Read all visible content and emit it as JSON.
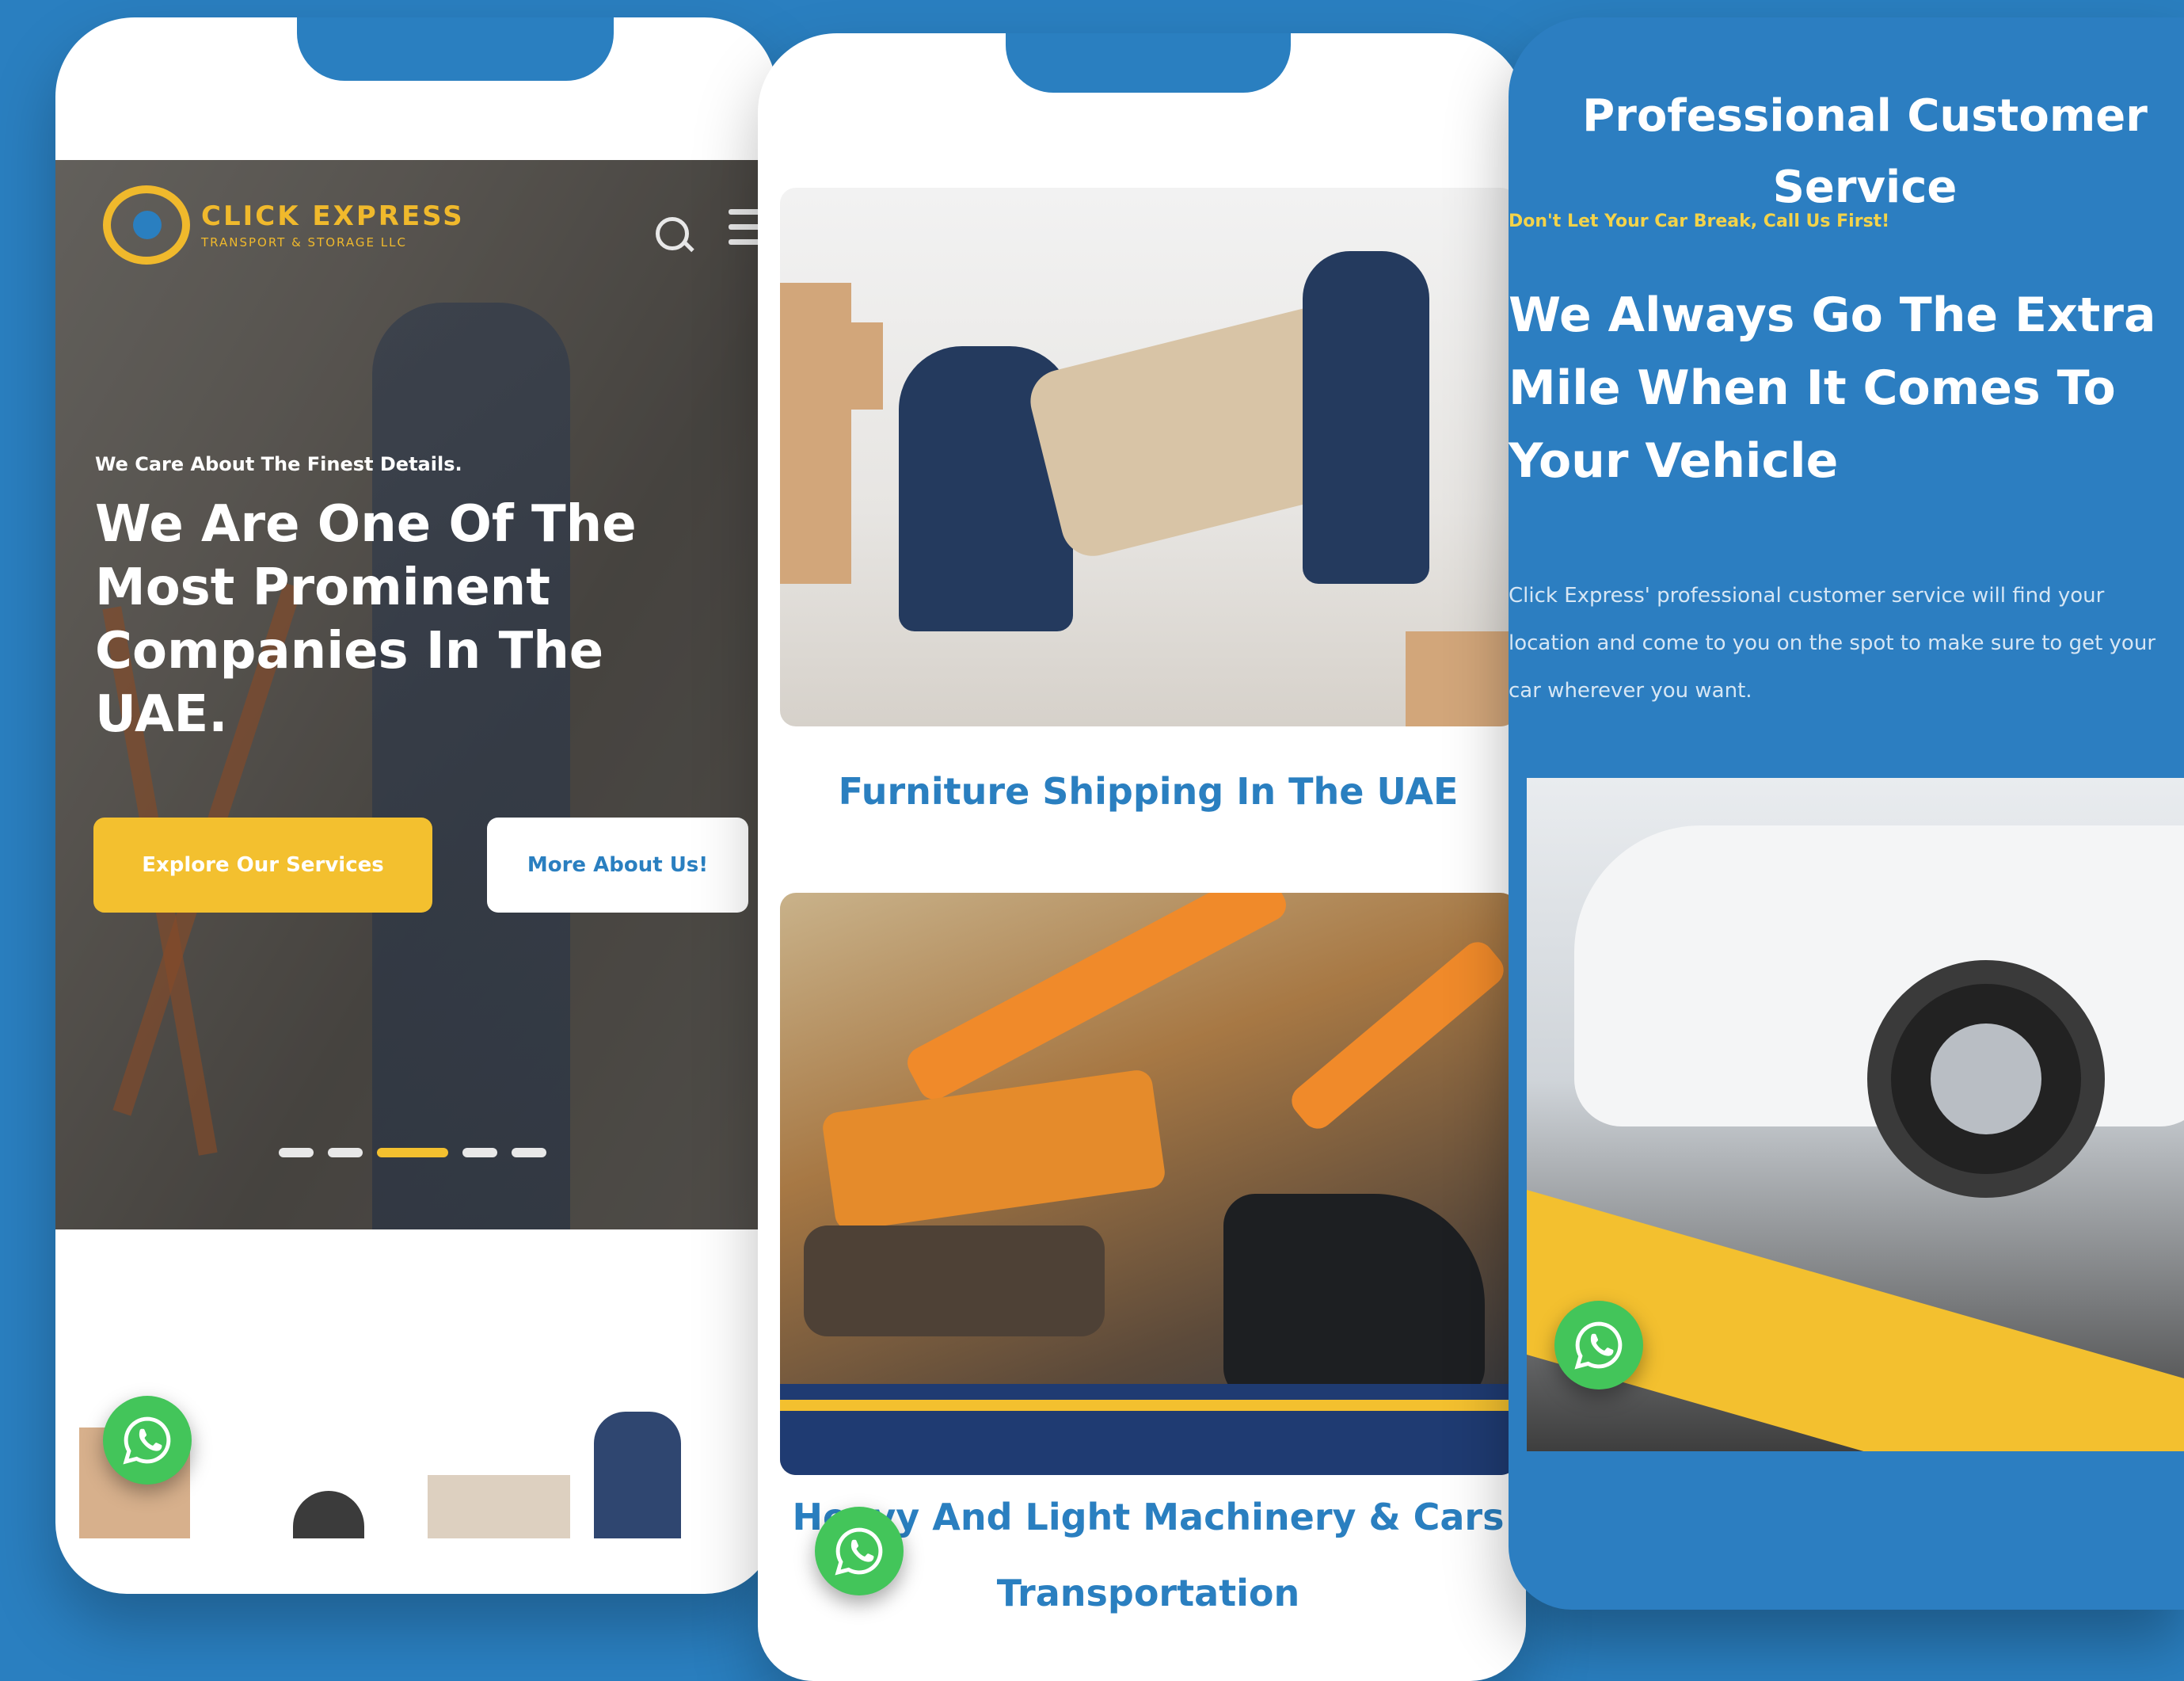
{
  "phone1": {
    "logo": {
      "title": "CLICK EXPRESS",
      "subtitle": "TRANSPORT & STORAGE LLC"
    },
    "hero": {
      "kicker": "We Care About The Finest Details.",
      "title": "We Are One Of The Most Prominent Companies In The UAE.",
      "primary_button": "Explore Our Services",
      "secondary_button": "More About Us!"
    },
    "slider": {
      "slide_count": 5,
      "active_index": 2
    }
  },
  "phone2": {
    "cards": [
      {
        "title": "Furniture Shipping In The UAE"
      },
      {
        "title": "Heavy And Light Machinery & Cars Transportation"
      }
    ]
  },
  "phone3": {
    "heading": "Professional Customer Service",
    "subheading": "Don't Let Your Car Break, Call Us First!",
    "title": "We Always Go The Extra Mile When It Comes To Your Vehicle",
    "body": "Click Express' professional customer service will find your location and come to you on the spot to make sure to get your car wherever you want."
  },
  "icons": {
    "whatsapp": "whatsapp-icon",
    "search": "search-icon",
    "menu": "hamburger-menu-icon"
  },
  "colors": {
    "background": "#2a7fc0",
    "accent_yellow": "#f3c02f",
    "whatsapp_green": "#43c55a"
  }
}
